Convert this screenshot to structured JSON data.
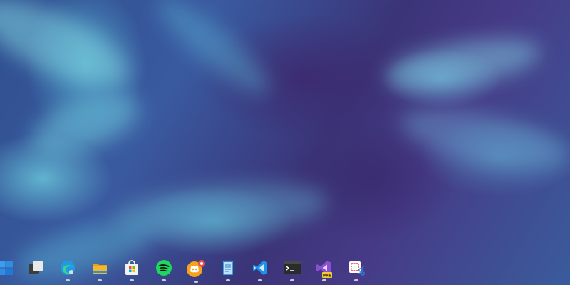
{
  "wallpaper": {
    "name": "wallpaper-smoke-teal-purple",
    "colors": [
      "#2f4f8f",
      "#3b3478",
      "#7fd3e0"
    ]
  },
  "taskbar": {
    "items": [
      {
        "name": "start-button",
        "icon": "windows-logo-icon",
        "running": false
      },
      {
        "name": "task-view-button",
        "icon": "task-view-icon",
        "running": false
      },
      {
        "name": "edge-taskbar-button",
        "icon": "edge-icon",
        "running": true
      },
      {
        "name": "file-explorer-taskbar-button",
        "icon": "folder-icon",
        "running": true
      },
      {
        "name": "microsoft-store-taskbar-button",
        "icon": "store-icon",
        "running": true
      },
      {
        "name": "spotify-taskbar-button",
        "icon": "spotify-icon",
        "running": true
      },
      {
        "name": "discord-taskbar-button",
        "icon": "discord-icon",
        "running": true,
        "badge": true
      },
      {
        "name": "notepad-taskbar-button",
        "icon": "notepad-icon",
        "running": true
      },
      {
        "name": "vscode-taskbar-button",
        "icon": "vscode-icon",
        "running": true
      },
      {
        "name": "terminal-taskbar-button",
        "icon": "terminal-icon",
        "running": true
      },
      {
        "name": "visual-studio-preview-taskbar-button",
        "icon": "visual-studio-icon",
        "badge_text": "PRE",
        "running": true
      },
      {
        "name": "snipping-tool-taskbar-button",
        "icon": "snipping-tool-icon",
        "running": true
      }
    ]
  },
  "colors": {
    "edge": "#1f9be3",
    "folder": "#f5b827",
    "store_red": "#f25022",
    "store_green": "#7fba00",
    "store_blue": "#00a4ef",
    "store_yellow": "#ffb900",
    "spotify": "#1ed760",
    "discord": "#f6a21b",
    "badge_red": "#e84f4f",
    "notepad": "#3aa0ee",
    "vscode": "#1e92e6",
    "terminal": "#2b2b2b",
    "visual_studio": "#8c4fd1",
    "snip_red": "#e43b45"
  }
}
